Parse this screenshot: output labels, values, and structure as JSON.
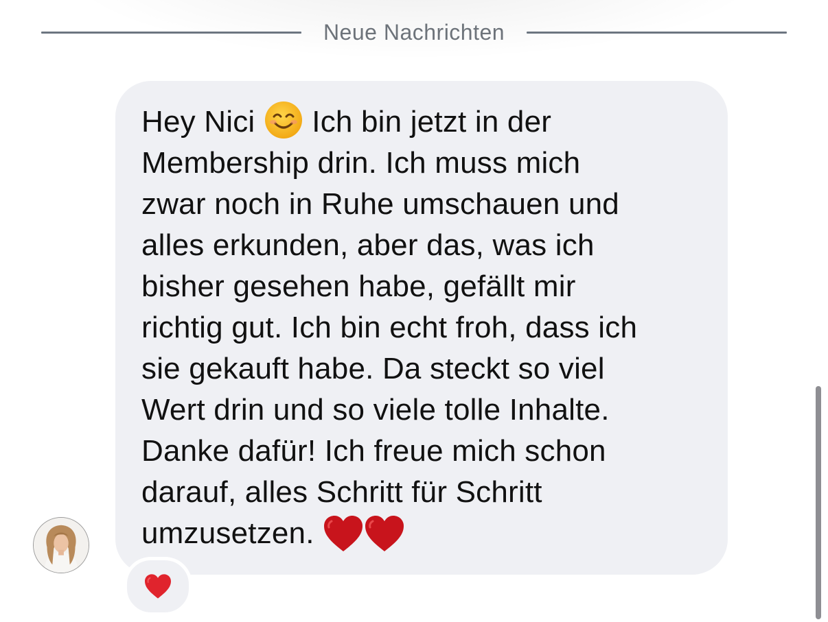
{
  "divider": {
    "label": "Neue Nachrichten"
  },
  "message": {
    "lines": [
      "Hey Nici",
      "Ich bin jetzt in der",
      "Membership drin. Ich muss mich",
      "zwar noch in Ruhe umschauen und",
      "alles erkunden, aber das, was ich",
      "bisher gesehen habe, gefällt mir",
      "richtig gut. Ich bin echt froh, dass ich",
      "sie gekauft habe. Da steckt so viel",
      "Wert drin und so viele tolle Inhalte.",
      "Danke dafür! Ich freue mich schon",
      "darauf, alles Schritt für Schritt",
      "umzusetzen."
    ],
    "inline_icons": [
      "smiling-face-emoji",
      "red-heart-emoji",
      "red-heart-emoji"
    ]
  },
  "reaction": {
    "icon": "red-heart-emoji"
  },
  "colors": {
    "bubble": "#eff0f4",
    "heart": "#c8141c",
    "divider": "#6c7580",
    "text": "#111111"
  }
}
